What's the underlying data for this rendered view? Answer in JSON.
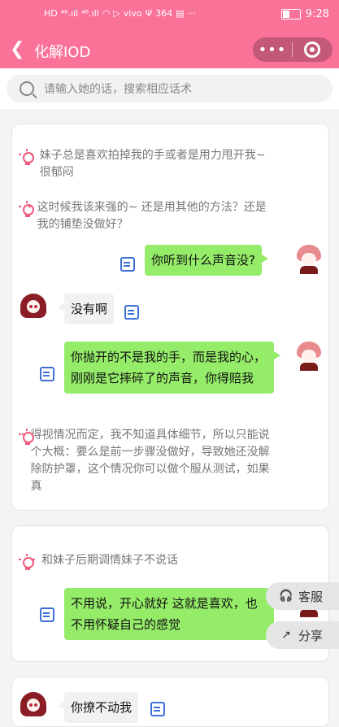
{
  "status_bar": {
    "left_icons": [
      "HD",
      "⁴⁶.ıll",
      "⁴⁶.ıll",
      "wifi",
      "▷",
      "vivo",
      "Ψ",
      "364",
      "▤",
      "···"
    ],
    "time": "9:28"
  },
  "nav": {
    "title": "化解IOD",
    "more": "•••"
  },
  "search": {
    "placeholder": "请输入她的话，搜索相应话术"
  },
  "card1": {
    "tip1": "妹子总是喜欢拍掉我的手或者是用力甩开我~很郁闷",
    "tip2": "这时候我该来强的~ 还是用其他的方法？还是我的铺垫没做好？",
    "msg1": "你听到什么声音没?",
    "msg2": "没有啊",
    "msg3": "你抛开的不是我的手，而是我的心，刚刚是它摔碎了的声音，你得赔我",
    "tip3": "得视情况而定，我不知道具体细节，所以只能说个大概：要么是前一步骤没做好，导致她还没解除防护罩，这个情况你可以做个服从测试，如果真"
  },
  "card2": {
    "tip1": "和妹子后期调情妹子不说话",
    "msg1": "不用说，开心就好 这就是喜欢，也不用怀疑自己的感觉"
  },
  "card3": {
    "msg1": "你撩不动我"
  },
  "float": {
    "service": "客服",
    "share": "分享"
  }
}
